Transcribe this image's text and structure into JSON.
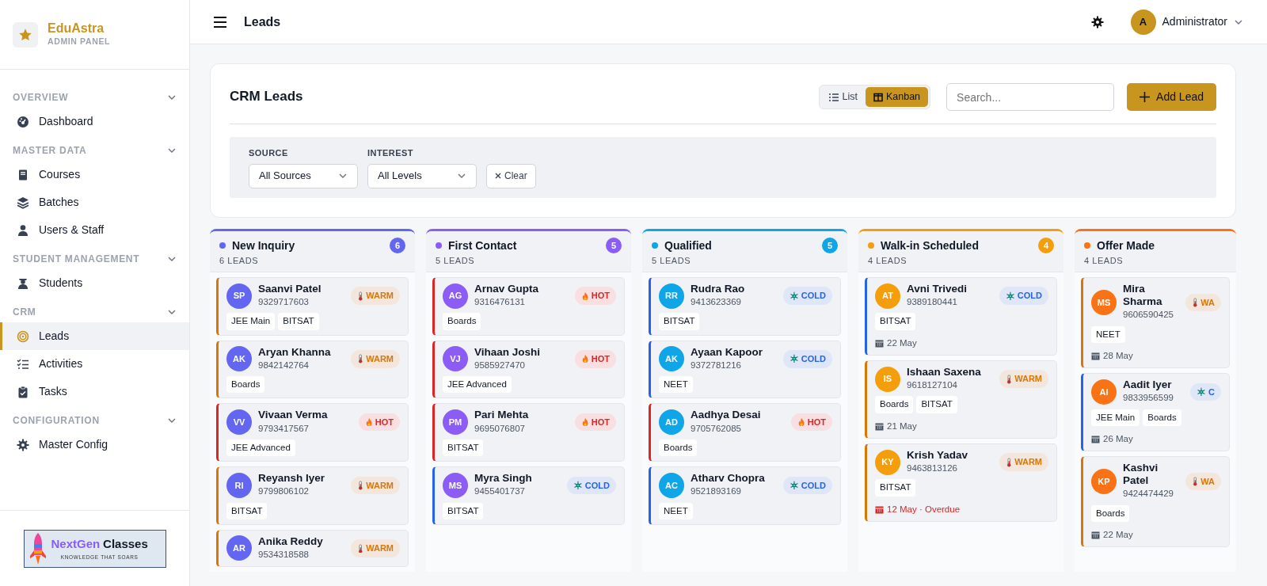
{
  "sidebar": {
    "brand": {
      "name": "EduAstra",
      "subtitle": "ADMIN PANEL"
    },
    "sections": [
      {
        "title": "OVERVIEW",
        "expanded": true,
        "items": [
          {
            "label": "Dashboard",
            "selected": false
          }
        ]
      },
      {
        "title": "MASTER DATA",
        "expanded": true,
        "items": [
          {
            "label": "Courses",
            "selected": false
          },
          {
            "label": "Batches",
            "selected": false
          },
          {
            "label": "Users & Staff",
            "selected": false
          }
        ]
      },
      {
        "title": "STUDENT MANAGEMENT",
        "expanded": true,
        "items": [
          {
            "label": "Students",
            "selected": false
          }
        ]
      },
      {
        "title": "CRM",
        "expanded": true,
        "items": [
          {
            "label": "Leads",
            "selected": true
          },
          {
            "label": "Activities",
            "selected": false
          },
          {
            "label": "Tasks",
            "selected": false
          }
        ]
      },
      {
        "title": "CONFIGURATION",
        "expanded": true,
        "items": [
          {
            "label": "Master Config",
            "selected": false
          }
        ]
      }
    ],
    "footer_logo": {
      "word_a": "NextGen",
      "word_b": "Classes",
      "tagline": "KNOWLEDGE THAT SOARS"
    }
  },
  "topbar": {
    "title": "Leads",
    "user": {
      "initial": "A",
      "name": "Administrator"
    }
  },
  "panel": {
    "title": "CRM Leads",
    "views": [
      {
        "label": "List",
        "selected": false
      },
      {
        "label": "Kanban",
        "selected": true
      }
    ],
    "search": {
      "placeholder": "Search..."
    },
    "add_button": "Add Lead",
    "filters": [
      {
        "label": "SOURCE",
        "value": "All Sources"
      },
      {
        "label": "INTEREST",
        "value": "All Levels"
      }
    ],
    "clear_button": "Clear"
  },
  "columns": [
    {
      "title": "New Inquiry",
      "color": "#6366f1",
      "count": "6",
      "subtitle": "6 LEADS",
      "leads": [
        {
          "initials": "SP",
          "name": "Saanvi Patel",
          "phone": "9329717603",
          "interest": {
            "kind": "warm",
            "label": "WARM"
          },
          "tags": [
            "JEE Main",
            "BITSAT"
          ]
        },
        {
          "initials": "AK",
          "name": "Aryan Khanna",
          "phone": "9842142764",
          "interest": {
            "kind": "warm",
            "label": "WARM"
          },
          "tags": [
            "Boards"
          ]
        },
        {
          "initials": "VV",
          "name": "Vivaan Verma",
          "phone": "9793417567",
          "interest": {
            "kind": "hot",
            "label": "HOT"
          },
          "tags": [
            "JEE Advanced"
          ]
        },
        {
          "initials": "RI",
          "name": "Reyansh Iyer",
          "phone": "9799806102",
          "interest": {
            "kind": "warm",
            "label": "WARM"
          },
          "tags": [
            "BITSAT"
          ]
        },
        {
          "initials": "AR",
          "name": "Anika Reddy",
          "phone": "9534318588",
          "interest": {
            "kind": "warm",
            "label": "WARM"
          }
        }
      ]
    },
    {
      "title": "First Contact",
      "color": "#8b5cf6",
      "count": "5",
      "subtitle": "5 LEADS",
      "leads": [
        {
          "initials": "AG",
          "name": "Arnav Gupta",
          "phone": "9316476131",
          "interest": {
            "kind": "hot",
            "label": "HOT"
          },
          "tags": [
            "Boards"
          ]
        },
        {
          "initials": "VJ",
          "name": "Vihaan Joshi",
          "phone": "9585927470",
          "interest": {
            "kind": "hot",
            "label": "HOT"
          },
          "tags": [
            "JEE Advanced"
          ]
        },
        {
          "initials": "PM",
          "name": "Pari Mehta",
          "phone": "9695076807",
          "interest": {
            "kind": "hot",
            "label": "HOT"
          },
          "tags": [
            "BITSAT"
          ]
        },
        {
          "initials": "MS",
          "name": "Myra Singh",
          "phone": "9455401737",
          "interest": {
            "kind": "cold",
            "label": "COLD"
          },
          "tags": [
            "BITSAT"
          ]
        }
      ]
    },
    {
      "title": "Qualified",
      "color": "#0ea5e9",
      "count": "5",
      "subtitle": "5 LEADS",
      "leads": [
        {
          "initials": "RR",
          "name": "Rudra Rao",
          "phone": "9413623369",
          "interest": {
            "kind": "cold",
            "label": "COLD"
          },
          "tags": [
            "BITSAT"
          ]
        },
        {
          "initials": "AK",
          "name": "Ayaan Kapoor",
          "phone": "9372781216",
          "interest": {
            "kind": "cold",
            "label": "COLD"
          },
          "tags": [
            "NEET"
          ]
        },
        {
          "initials": "AD",
          "name": "Aadhya Desai",
          "phone": "9705762085",
          "interest": {
            "kind": "hot",
            "label": "HOT"
          },
          "tags": [
            "Boards"
          ]
        },
        {
          "initials": "AC",
          "name": "Atharv Chopra",
          "phone": "9521893169",
          "interest": {
            "kind": "cold",
            "label": "COLD"
          },
          "tags": [
            "NEET"
          ]
        }
      ]
    },
    {
      "title": "Walk-in Scheduled",
      "color": "#f59e0b",
      "count": "4",
      "subtitle": "4 LEADS",
      "leads": [
        {
          "initials": "AT",
          "name": "Avni Trivedi",
          "phone": "9389180441",
          "interest": {
            "kind": "cold",
            "label": "COLD"
          },
          "tags": [
            "BITSAT"
          ],
          "date": "22 May",
          "overdue": false
        },
        {
          "initials": "IS",
          "name": "Ishaan Saxena",
          "phone": "9618127104",
          "interest": {
            "kind": "warm",
            "label": "WARM"
          },
          "tags": [
            "Boards",
            "BITSAT"
          ],
          "date": "21 May",
          "overdue": false
        },
        {
          "initials": "KY",
          "name": "Krish Yadav",
          "phone": "9463813126",
          "interest": {
            "kind": "warm",
            "label": "WARM"
          },
          "tags": [
            "BITSAT"
          ],
          "date": "12 May · Overdue",
          "overdue": true
        }
      ]
    },
    {
      "title": "Offer Made",
      "color": "#f97316",
      "subtitle": "4 LEADS",
      "leads": [
        {
          "initials": "MS",
          "name": "Mira Sharma",
          "phone": "9606590425",
          "interest": {
            "kind": "warm",
            "label": "WA"
          },
          "tags": [
            "NEET"
          ],
          "date": "28 May",
          "overdue": false
        },
        {
          "initials": "AI",
          "name": "Aadit Iyer",
          "phone": "9833956599",
          "interest": {
            "kind": "cold",
            "label": "C"
          },
          "tags": [
            "JEE Main",
            "Boards"
          ],
          "date": "26 May",
          "overdue": false
        },
        {
          "initials": "KP",
          "name": "Kashvi Patel",
          "phone": "9424474429",
          "interest": {
            "kind": "warm",
            "label": "WA"
          },
          "tags": [
            "Boards"
          ],
          "date": "22 May",
          "overdue": false
        }
      ]
    }
  ]
}
